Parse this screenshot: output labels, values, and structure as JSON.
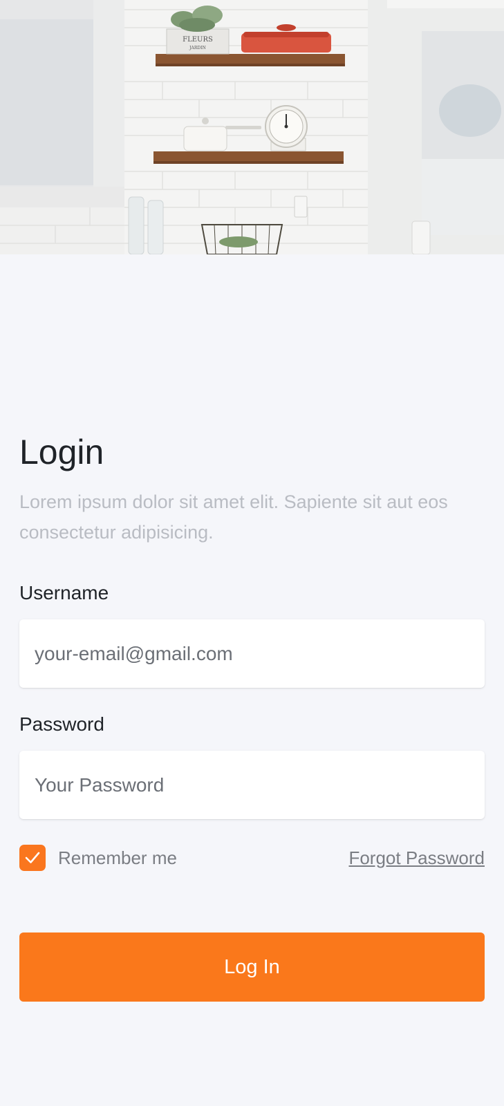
{
  "login": {
    "title": "Login",
    "subtitle": "Lorem ipsum dolor sit amet elit. Sapiente sit aut eos consectetur adipisicing."
  },
  "form": {
    "username_label": "Username",
    "username_placeholder": "your-email@gmail.com",
    "password_label": "Password",
    "password_placeholder": "Your Password",
    "remember_label": "Remember me",
    "remember_checked": true,
    "forgot_label": "Forgot Password",
    "submit_label": "Log In"
  },
  "hero": {
    "jar_text": "FLEURS",
    "jar_subtext": "JARDIN"
  },
  "colors": {
    "accent": "#fa781b",
    "background": "#f5f6fa",
    "text": "#1f2328",
    "muted": "#b9bcc3"
  }
}
